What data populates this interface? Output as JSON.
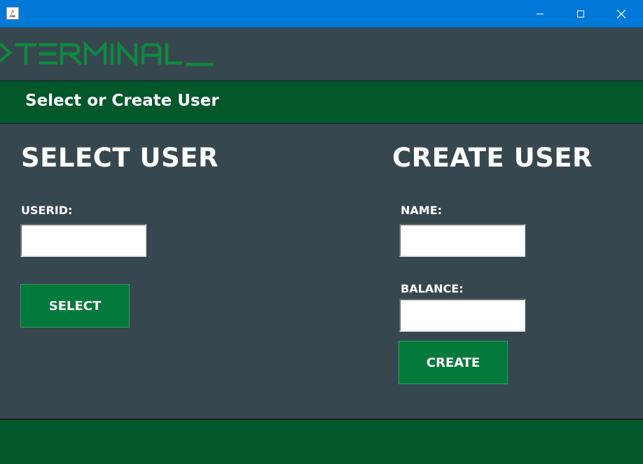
{
  "window": {
    "titlebar_color": "#0078d7",
    "controls": {
      "minimize_icon": "minimize-icon",
      "maximize_icon": "maximize-icon",
      "close_icon": "close-icon"
    }
  },
  "logo": {
    "text": ">TERMINAL_",
    "color": "#0c8a3e"
  },
  "header": {
    "title": "Select or Create User"
  },
  "select_user": {
    "heading": "SELECT USER",
    "userid_label": "USERID:",
    "userid_value": "",
    "button_label": "SELECT"
  },
  "create_user": {
    "heading": "CREATE USER",
    "name_label": "NAME:",
    "name_value": "",
    "balance_label": "BALANCE:",
    "balance_value": "",
    "button_label": "CREATE"
  },
  "colors": {
    "background": "#36474f",
    "band": "#02572b",
    "button": "#04793c"
  }
}
